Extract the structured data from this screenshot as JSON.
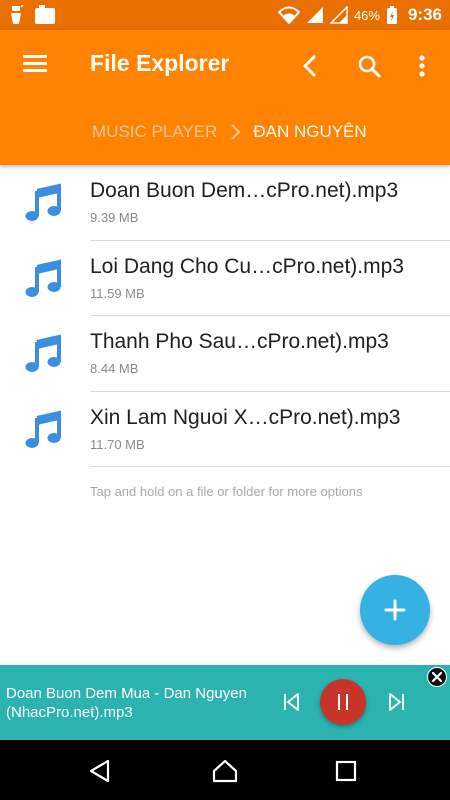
{
  "status_bar": {
    "battery_percent": "46%",
    "time": "9:36"
  },
  "toolbar": {
    "title": "File Explorer",
    "breadcrumb": [
      "MUSIC PLAYER",
      "ĐAN NGUYÊN"
    ]
  },
  "files": [
    {
      "name": "Doan Buon Dem…cPro.net).mp3",
      "size": "9.39 MB"
    },
    {
      "name": "Loi Dang Cho Cu…cPro.net).mp3",
      "size": "11.59 MB"
    },
    {
      "name": "Thanh Pho Sau…cPro.net).mp3",
      "size": "8.44 MB"
    },
    {
      "name": "Xin Lam Nguoi X…cPro.net).mp3",
      "size": "11.70 MB"
    }
  ],
  "hint": "Tap and hold on a file or folder for more options",
  "player": {
    "track_title": "Doan Buon Dem Mua - Dan Nguyen (NhacPro.net).mp3"
  },
  "colors": {
    "status_bar": "#e86f00",
    "toolbar": "#ff8200",
    "music_icon": "#3c8fe0",
    "fab": "#35b2e3",
    "player": "#2bb3b0",
    "pause_button": "#c8342a"
  }
}
